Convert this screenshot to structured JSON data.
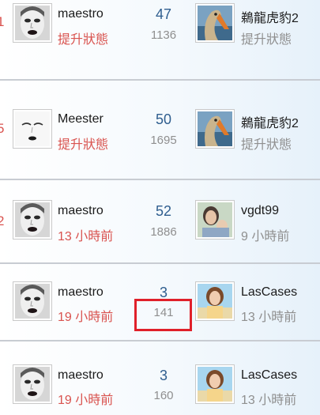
{
  "rows": [
    {
      "rank": "1",
      "left_user": {
        "avatar": "woman-face-dark-lips",
        "name": "maestro",
        "status": "提升狀態"
      },
      "count_primary": "47",
      "count_secondary": "1136",
      "right_user": {
        "avatar": "bird-photo",
        "name": "鵜龍虎豹2",
        "status": "提升狀態"
      }
    },
    {
      "rank": "5",
      "left_user": {
        "avatar": "sketched-face",
        "name": "Meester",
        "status": "提升狀態"
      },
      "count_primary": "50",
      "count_secondary": "1695",
      "right_user": {
        "avatar": "bird-photo",
        "name": "鵜龍虎豹2",
        "status": "提升狀態"
      }
    },
    {
      "rank": "2",
      "left_user": {
        "avatar": "woman-face-dark-lips",
        "name": "maestro",
        "status": "13 小時前"
      },
      "count_primary": "52",
      "count_secondary": "1886",
      "right_user": {
        "avatar": "portrait-photo",
        "name": "vgdt99",
        "status": "9 小時前"
      }
    },
    {
      "rank": "",
      "left_user": {
        "avatar": "woman-face-dark-lips",
        "name": "maestro",
        "status": "19 小時前"
      },
      "count_primary": "3",
      "count_secondary": "141",
      "right_user": {
        "avatar": "beach-photo",
        "name": "LasCases",
        "status": "13 小時前"
      }
    },
    {
      "rank": "",
      "left_user": {
        "avatar": "woman-face-dark-lips",
        "name": "maestro",
        "status": "19 小時前"
      },
      "count_primary": "3",
      "count_secondary": "160",
      "right_user": {
        "avatar": "beach-photo",
        "name": "LasCases",
        "status": "13 小時前"
      }
    }
  ],
  "colors": {
    "accent_red": "#d9534f",
    "link_blue": "#2f5e8f",
    "muted": "#8f8f8f",
    "highlight_box": "#e0202a"
  }
}
